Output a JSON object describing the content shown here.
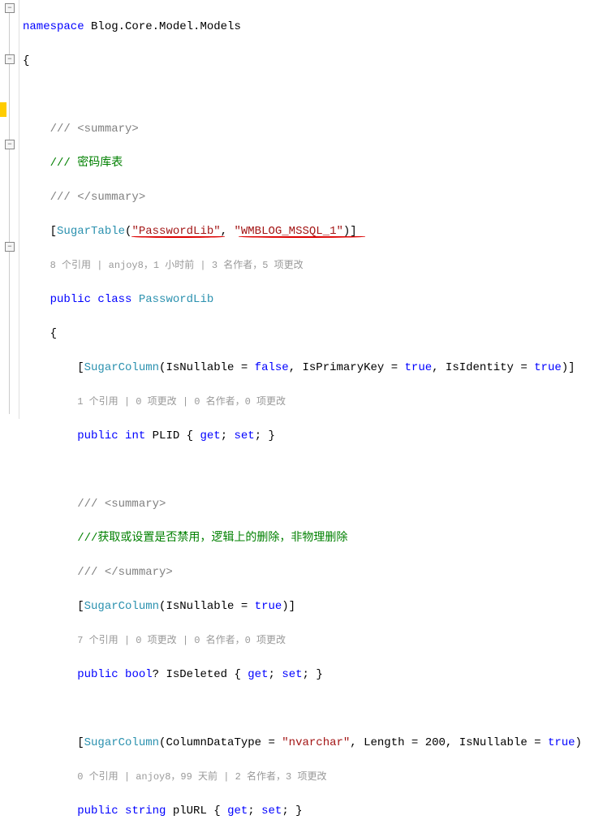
{
  "code": {
    "namespace_kw": "namespace",
    "namespace_name": " Blog.Core.Model.Models",
    "open_brace": "{",
    "summary_open": "/// <summary>",
    "class_comment": "/// 密码库表",
    "summary_close": "/// </summary>",
    "attr_open": "[",
    "sugartable": "SugarTable",
    "paren_open": "(",
    "table_name": "\"PasswordLib\"",
    "comma": ", ",
    "db_name": "\"WMBLOG_MSSQL_1\"",
    "paren_close": ")]",
    "class_codelens": "8 个引用 | anjoy8，1 小时前 | 3 名作者，5 项更改",
    "public_kw": "public",
    "class_kw": " class ",
    "class_name": "PasswordLib",
    "brace2": "{",
    "sugarcol": "SugarColumn",
    "nullable_false": "(IsNullable = ",
    "false_kw": "false",
    "pk": ", IsPrimaryKey = ",
    "true_kw": "true",
    "identity": ", IsIdentity = ",
    "close_sq": ")]",
    "plid_codelens": "1 个引用 | 0 项更改 | 0 名作者，0 项更改",
    "int_kw": " int",
    "plid": " PLID { ",
    "get_kw": "get",
    "set_kw": "set",
    "prop_close": "; }",
    "isdeleted_comment": "///获取或设置是否禁用，逻辑上的删除，非物理删除",
    "nullable_true": "(IsNullable = ",
    "isdeleted_codelens": "7 个引用 | 0 项更改 | 0 名作者，0 项更改",
    "bool_kw": " bool",
    "nullable_q": "?",
    "isdeleted": " IsDeleted { ",
    "coldatatype": "(ColumnDataType = ",
    "nvarchar": "\"nvarchar\"",
    "length": ", Length = 200, IsNullable = ",
    "plurl_codelens": "0 个引用 | anjoy8，99 天前 | 2 名作者，3 项更改",
    "string_kw": " string",
    "plurl": " plURL { "
  }
}
